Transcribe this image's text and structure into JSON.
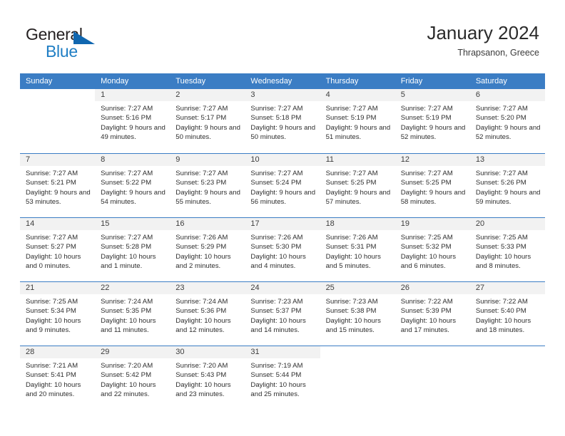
{
  "brand": {
    "name_part1": "General",
    "name_part2": "Blue"
  },
  "header": {
    "title": "January 2024",
    "subtitle": "Thrapsanon, Greece"
  },
  "weekdays": [
    "Sunday",
    "Monday",
    "Tuesday",
    "Wednesday",
    "Thursday",
    "Friday",
    "Saturday"
  ],
  "colors": {
    "header_blue": "#3b7dc4",
    "logo_blue": "#1f7ec4",
    "day_band": "#f2f2f2"
  },
  "weeks": [
    [
      {
        "day": "",
        "sunrise": "",
        "sunset": "",
        "daylight": "",
        "empty": true
      },
      {
        "day": "1",
        "sunrise": "Sunrise: 7:27 AM",
        "sunset": "Sunset: 5:16 PM",
        "daylight": "Daylight: 9 hours and 49 minutes."
      },
      {
        "day": "2",
        "sunrise": "Sunrise: 7:27 AM",
        "sunset": "Sunset: 5:17 PM",
        "daylight": "Daylight: 9 hours and 50 minutes."
      },
      {
        "day": "3",
        "sunrise": "Sunrise: 7:27 AM",
        "sunset": "Sunset: 5:18 PM",
        "daylight": "Daylight: 9 hours and 50 minutes."
      },
      {
        "day": "4",
        "sunrise": "Sunrise: 7:27 AM",
        "sunset": "Sunset: 5:19 PM",
        "daylight": "Daylight: 9 hours and 51 minutes."
      },
      {
        "day": "5",
        "sunrise": "Sunrise: 7:27 AM",
        "sunset": "Sunset: 5:19 PM",
        "daylight": "Daylight: 9 hours and 52 minutes."
      },
      {
        "day": "6",
        "sunrise": "Sunrise: 7:27 AM",
        "sunset": "Sunset: 5:20 PM",
        "daylight": "Daylight: 9 hours and 52 minutes."
      }
    ],
    [
      {
        "day": "7",
        "sunrise": "Sunrise: 7:27 AM",
        "sunset": "Sunset: 5:21 PM",
        "daylight": "Daylight: 9 hours and 53 minutes."
      },
      {
        "day": "8",
        "sunrise": "Sunrise: 7:27 AM",
        "sunset": "Sunset: 5:22 PM",
        "daylight": "Daylight: 9 hours and 54 minutes."
      },
      {
        "day": "9",
        "sunrise": "Sunrise: 7:27 AM",
        "sunset": "Sunset: 5:23 PM",
        "daylight": "Daylight: 9 hours and 55 minutes."
      },
      {
        "day": "10",
        "sunrise": "Sunrise: 7:27 AM",
        "sunset": "Sunset: 5:24 PM",
        "daylight": "Daylight: 9 hours and 56 minutes."
      },
      {
        "day": "11",
        "sunrise": "Sunrise: 7:27 AM",
        "sunset": "Sunset: 5:25 PM",
        "daylight": "Daylight: 9 hours and 57 minutes."
      },
      {
        "day": "12",
        "sunrise": "Sunrise: 7:27 AM",
        "sunset": "Sunset: 5:25 PM",
        "daylight": "Daylight: 9 hours and 58 minutes."
      },
      {
        "day": "13",
        "sunrise": "Sunrise: 7:27 AM",
        "sunset": "Sunset: 5:26 PM",
        "daylight": "Daylight: 9 hours and 59 minutes."
      }
    ],
    [
      {
        "day": "14",
        "sunrise": "Sunrise: 7:27 AM",
        "sunset": "Sunset: 5:27 PM",
        "daylight": "Daylight: 10 hours and 0 minutes."
      },
      {
        "day": "15",
        "sunrise": "Sunrise: 7:27 AM",
        "sunset": "Sunset: 5:28 PM",
        "daylight": "Daylight: 10 hours and 1 minute."
      },
      {
        "day": "16",
        "sunrise": "Sunrise: 7:26 AM",
        "sunset": "Sunset: 5:29 PM",
        "daylight": "Daylight: 10 hours and 2 minutes."
      },
      {
        "day": "17",
        "sunrise": "Sunrise: 7:26 AM",
        "sunset": "Sunset: 5:30 PM",
        "daylight": "Daylight: 10 hours and 4 minutes."
      },
      {
        "day": "18",
        "sunrise": "Sunrise: 7:26 AM",
        "sunset": "Sunset: 5:31 PM",
        "daylight": "Daylight: 10 hours and 5 minutes."
      },
      {
        "day": "19",
        "sunrise": "Sunrise: 7:25 AM",
        "sunset": "Sunset: 5:32 PM",
        "daylight": "Daylight: 10 hours and 6 minutes."
      },
      {
        "day": "20",
        "sunrise": "Sunrise: 7:25 AM",
        "sunset": "Sunset: 5:33 PM",
        "daylight": "Daylight: 10 hours and 8 minutes."
      }
    ],
    [
      {
        "day": "21",
        "sunrise": "Sunrise: 7:25 AM",
        "sunset": "Sunset: 5:34 PM",
        "daylight": "Daylight: 10 hours and 9 minutes."
      },
      {
        "day": "22",
        "sunrise": "Sunrise: 7:24 AM",
        "sunset": "Sunset: 5:35 PM",
        "daylight": "Daylight: 10 hours and 11 minutes."
      },
      {
        "day": "23",
        "sunrise": "Sunrise: 7:24 AM",
        "sunset": "Sunset: 5:36 PM",
        "daylight": "Daylight: 10 hours and 12 minutes."
      },
      {
        "day": "24",
        "sunrise": "Sunrise: 7:23 AM",
        "sunset": "Sunset: 5:37 PM",
        "daylight": "Daylight: 10 hours and 14 minutes."
      },
      {
        "day": "25",
        "sunrise": "Sunrise: 7:23 AM",
        "sunset": "Sunset: 5:38 PM",
        "daylight": "Daylight: 10 hours and 15 minutes."
      },
      {
        "day": "26",
        "sunrise": "Sunrise: 7:22 AM",
        "sunset": "Sunset: 5:39 PM",
        "daylight": "Daylight: 10 hours and 17 minutes."
      },
      {
        "day": "27",
        "sunrise": "Sunrise: 7:22 AM",
        "sunset": "Sunset: 5:40 PM",
        "daylight": "Daylight: 10 hours and 18 minutes."
      }
    ],
    [
      {
        "day": "28",
        "sunrise": "Sunrise: 7:21 AM",
        "sunset": "Sunset: 5:41 PM",
        "daylight": "Daylight: 10 hours and 20 minutes."
      },
      {
        "day": "29",
        "sunrise": "Sunrise: 7:20 AM",
        "sunset": "Sunset: 5:42 PM",
        "daylight": "Daylight: 10 hours and 22 minutes."
      },
      {
        "day": "30",
        "sunrise": "Sunrise: 7:20 AM",
        "sunset": "Sunset: 5:43 PM",
        "daylight": "Daylight: 10 hours and 23 minutes."
      },
      {
        "day": "31",
        "sunrise": "Sunrise: 7:19 AM",
        "sunset": "Sunset: 5:44 PM",
        "daylight": "Daylight: 10 hours and 25 minutes."
      },
      {
        "day": "",
        "sunrise": "",
        "sunset": "",
        "daylight": "",
        "empty": true
      },
      {
        "day": "",
        "sunrise": "",
        "sunset": "",
        "daylight": "",
        "empty": true
      },
      {
        "day": "",
        "sunrise": "",
        "sunset": "",
        "daylight": "",
        "empty": true
      }
    ]
  ]
}
